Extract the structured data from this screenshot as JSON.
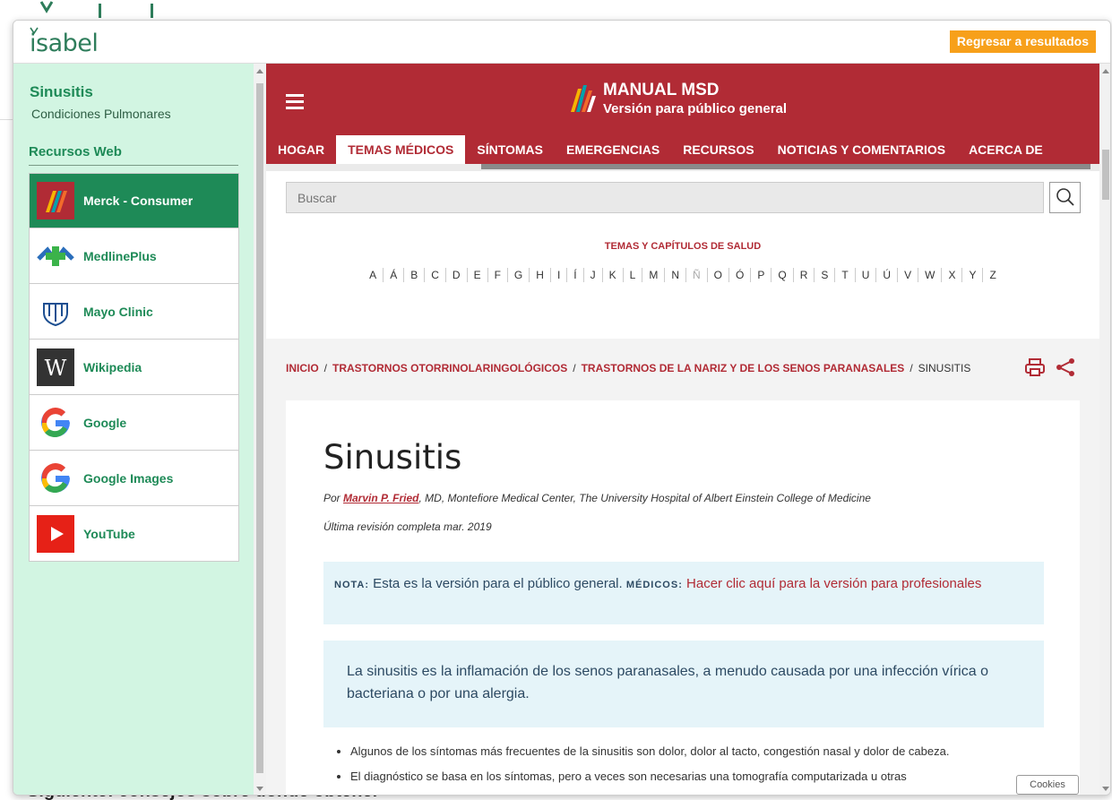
{
  "background": {
    "footer_text": "Siguiente: consejos sobre dónde obtener"
  },
  "modal": {
    "logo_text": "isabel",
    "return_button": "Regresar a resultados"
  },
  "sidebar": {
    "topic": "Sinusitis",
    "subtopic": "Condiciones Pulmonares",
    "section_title": "Recursos Web",
    "items": [
      {
        "label": "Merck - Consumer",
        "icon": "merck-logo-icon",
        "active": true
      },
      {
        "label": "MedlinePlus",
        "icon": "medlineplus-logo-icon"
      },
      {
        "label": "Mayo Clinic",
        "icon": "mayo-clinic-logo-icon"
      },
      {
        "label": "Wikipedia",
        "icon": "wikipedia-logo-icon"
      },
      {
        "label": "Google",
        "icon": "google-logo-icon"
      },
      {
        "label": "Google Images",
        "icon": "google-logo-icon"
      },
      {
        "label": "YouTube",
        "icon": "youtube-logo-icon"
      }
    ]
  },
  "msd": {
    "title": "MANUAL MSD",
    "subtitle": "Versión para público general",
    "nav": [
      "HOGAR",
      "TEMAS MÉDICOS",
      "SÍNTOMAS",
      "EMERGENCIAS",
      "RECURSOS",
      "NOTICIAS Y COMENTARIOS",
      "ACERCA DE"
    ],
    "active_nav": "TEMAS MÉDICOS",
    "search_placeholder": "Buscar",
    "health_topics_title": "TEMAS Y CAPÍTULOS DE SALUD",
    "letters": [
      "A",
      "Á",
      "B",
      "C",
      "D",
      "E",
      "F",
      "G",
      "H",
      "I",
      "Í",
      "J",
      "K",
      "L",
      "M",
      "N",
      "Ñ",
      "O",
      "Ó",
      "P",
      "Q",
      "R",
      "S",
      "T",
      "U",
      "Ú",
      "V",
      "W",
      "X",
      "Y",
      "Z"
    ],
    "breadcrumb": [
      "INICIO",
      "TRASTORNOS OTORRINOLARINGOLÓGICOS",
      "TRASTORNOS DE LA NARIZ Y DE LOS SENOS PARANASALES"
    ],
    "breadcrumb_current": "SINUSITIS"
  },
  "article": {
    "title": "Sinusitis",
    "byline_prefix": "Por ",
    "author": "Marvin P. Fried",
    "byline_suffix": ", MD, Montefiore Medical Center, The University Hospital of Albert Einstein College of Medicine",
    "reviewed": "Última revisión completa mar. 2019",
    "note_label": "NOTA:",
    "note_text": " Esta es la versión para el público general. ",
    "doctors_label": "MÉDICOS:",
    "doctors_link": " Hacer clic aquí para la versión para profesionales",
    "summary": "La sinusitis es la inflamación de los senos paranasales, a menudo causada por una infección vírica o bacteriana o por una alergia.",
    "bullets": [
      "Algunos de los síntomas más frecuentes de la sinusitis son dolor, dolor al tacto, congestión nasal y dolor de cabeza.",
      "El diagnóstico se basa en los síntomas, pero a veces son necesarias una tomografía computarizada u otras"
    ]
  },
  "cookies_button": "Cookies",
  "colors": {
    "msd_red": "#b12b35",
    "isabel_green": "#1e8a57",
    "sidebar_bg": "#d2f5e2",
    "return_orange": "#f7a01a",
    "note_bg": "#e5f4f9"
  }
}
